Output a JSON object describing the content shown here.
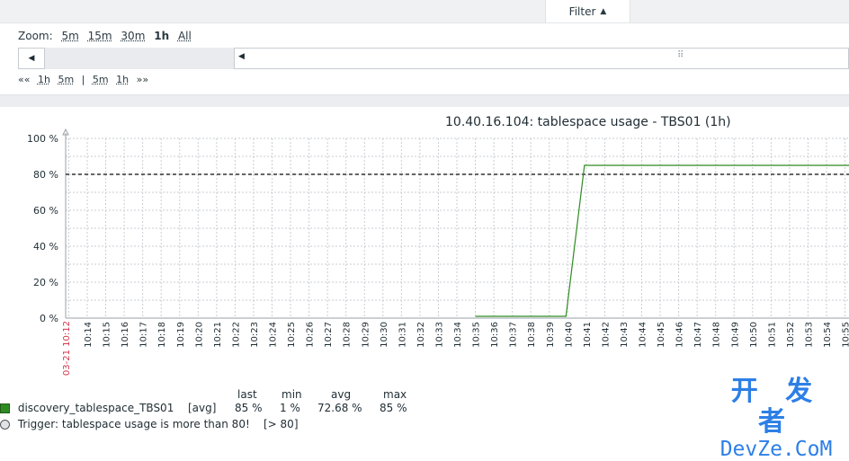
{
  "filter_tab": {
    "label": "Filter",
    "icon": "caret-up-icon"
  },
  "zoom": {
    "label": "Zoom:",
    "options": [
      "5m",
      "15m",
      "30m",
      "1h",
      "All"
    ],
    "active": "1h"
  },
  "scrollbar": {
    "left_button_icon": "left-arrow-icon",
    "thumb_icon": "left-arrow-icon",
    "grip_icon": "grip-icon"
  },
  "nav": {
    "back_all": "««",
    "back_1h": "1h",
    "back_5m": "5m",
    "divider": "|",
    "fwd_5m": "5m",
    "fwd_1h": "1h",
    "fwd_all": "»»"
  },
  "chart_data": {
    "type": "line",
    "title": "10.40.16.104: tablespace usage - TBS01 (1h)",
    "ylim": [
      0,
      100
    ],
    "y_ticks": [
      "100 %",
      "80 %",
      "60 %",
      "40 %",
      "20 %",
      "0 %"
    ],
    "start_label": "03-21 10:12",
    "x_labels": [
      "10:14",
      "10:15",
      "10:16",
      "10:17",
      "10:18",
      "10:19",
      "10:20",
      "10:21",
      "10:22",
      "10:23",
      "10:24",
      "10:25",
      "10:26",
      "10:27",
      "10:28",
      "10:29",
      "10:30",
      "10:31",
      "10:32",
      "10:33",
      "10:34",
      "10:35",
      "10:36",
      "10:37",
      "10:38",
      "10:39",
      "10:40",
      "10:41",
      "10:42",
      "10:43",
      "10:44",
      "10:45",
      "10:46",
      "10:47",
      "10:48",
      "10:49",
      "10:50",
      "10:51",
      "10:52",
      "10:53",
      "10:54",
      "10:55"
    ],
    "grid": true,
    "series": [
      {
        "name": "discovery_tablespace_TBS01",
        "color": "#2e8b22",
        "points": [
          [
            "10:35",
            1
          ],
          [
            "10:40",
            1
          ],
          [
            "10:40",
            1
          ],
          [
            "10:41",
            85
          ],
          [
            "10:55",
            85
          ]
        ]
      }
    ],
    "trigger": {
      "value": 80,
      "color": "#333333"
    }
  },
  "legend": {
    "headers": {
      "last": "last",
      "min": "min",
      "avg": "avg",
      "max": "max"
    },
    "series": {
      "name": "discovery_tablespace_TBS01",
      "func": "[avg]",
      "last": "85 %",
      "min": "1 %",
      "avg": "72.68 %",
      "max": "85 %"
    },
    "trigger": {
      "text": "Trigger: tablespace usage is more than 80!",
      "value": "[> 80]"
    }
  },
  "watermark": {
    "line1": "开 发 者",
    "line2": "DevZe.CoM"
  }
}
